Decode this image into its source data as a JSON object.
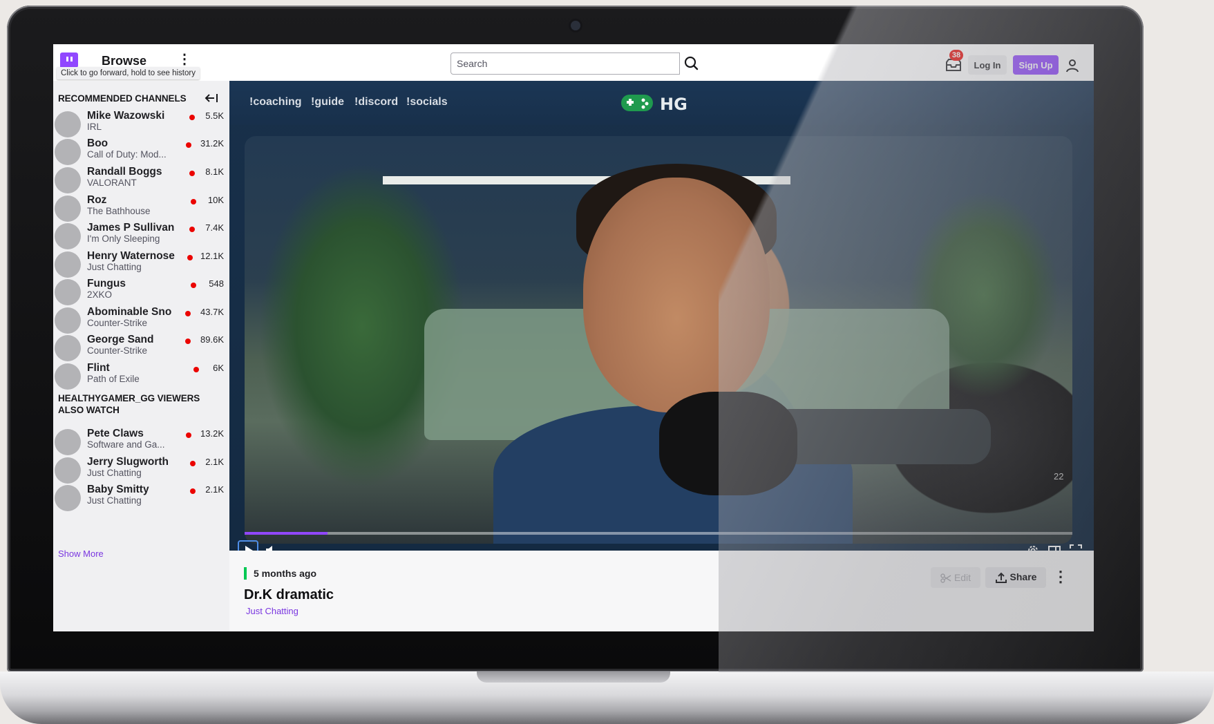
{
  "topnav": {
    "browse_label": "Browse",
    "tooltip": "Click to go forward, hold to see history",
    "search_placeholder": "Search",
    "notification_count": "38",
    "login_label": "Log In",
    "signup_label": "Sign Up"
  },
  "sidebar": {
    "recommended_heading": "RECOMMENDED CHANNELS",
    "recommended": [
      {
        "name": "Mike Wazowski",
        "game": "IRL",
        "viewers": "5.5K"
      },
      {
        "name": "Boo",
        "game": "Call of Duty: Mod...",
        "viewers": "31.2K"
      },
      {
        "name": "Randall Boggs",
        "game": "VALORANT",
        "viewers": "8.1K"
      },
      {
        "name": "Roz",
        "game": "The Bathhouse",
        "viewers": "10K"
      },
      {
        "name": "James P Sullivan",
        "game": "I'm Only Sleeping",
        "viewers": "7.4K"
      },
      {
        "name": "Henry Waternose",
        "game": "Just Chatting",
        "viewers": "12.1K"
      },
      {
        "name": "Fungus",
        "game": "2XKO",
        "viewers": "548"
      },
      {
        "name": "Abominable Sno",
        "game": "Counter-Strike",
        "viewers": "43.7K"
      },
      {
        "name": "George Sand",
        "game": "Counter-Strike",
        "viewers": "89.6K"
      },
      {
        "name": "Flint",
        "game": "Path of Exile",
        "viewers": "6K"
      }
    ],
    "also_watch_heading_line1": "HEALTHYGAMER_GG VIEWERS",
    "also_watch_heading_line2": "ALSO WATCH",
    "also_watch": [
      {
        "name": "Pete Claws",
        "game": "Software and Ga...",
        "viewers": "13.2K"
      },
      {
        "name": "Jerry Slugworth",
        "game": "Just Chatting",
        "viewers": "2.1K"
      },
      {
        "name": "Baby Smitty",
        "game": "Just Chatting",
        "viewers": "2.1K"
      }
    ],
    "show_more": "Show More"
  },
  "player": {
    "commands": [
      "!coaching",
      "!guide",
      "!discord",
      "!socials"
    ],
    "brand": "HG",
    "timestamp": "22",
    "progress_fraction": 0.1
  },
  "video_info": {
    "age": "5 months ago",
    "title": "Dr.K dramatic",
    "category": "Just Chatting",
    "edit_label": "Edit",
    "share_label": "Share"
  },
  "colors": {
    "accent": "#9147ff",
    "live_red": "#eb0400",
    "live_green": "#00c853"
  }
}
